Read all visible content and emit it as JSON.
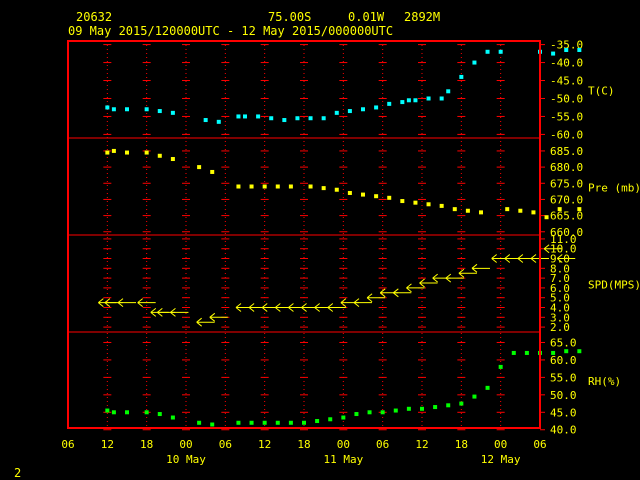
{
  "header": {
    "station": "20632",
    "lat": "75.00S",
    "lon": "0.01W",
    "elev": "2892M",
    "period": "09 May 2015/120000UTC - 12 May 2015/000000UTC"
  },
  "page_number": "2",
  "colors": {
    "frame": "#ff0000",
    "grid": "#ff0000",
    "text": "#ffff00",
    "temperature": "#00ffff",
    "pressure": "#ffff00",
    "wind": "#ffff00",
    "rh": "#00ff00",
    "background": "#000000"
  },
  "chart_data": [
    {
      "type": "scatter",
      "ylabel": "T(C)",
      "ylim": [
        -61,
        -34
      ],
      "ticks": [
        "-35.0",
        "-40.0",
        "-45.0",
        "-50.0",
        "-55.0",
        "-60.0"
      ],
      "tick_values": [
        -35,
        -40,
        -45,
        -50,
        -55,
        -60
      ],
      "x": [
        12,
        13,
        15,
        18,
        20,
        22,
        27,
        29,
        32,
        33,
        35,
        37,
        39,
        41,
        43,
        45,
        47,
        49,
        51,
        53,
        55,
        57,
        58,
        59,
        61,
        63,
        64,
        66,
        68,
        70,
        72,
        78,
        80,
        82,
        84
      ],
      "y": [
        -52.5,
        -53,
        -53,
        -53,
        -53.5,
        -54,
        -56,
        -56.5,
        -55,
        -55,
        -55,
        -55.5,
        -56,
        -55.5,
        -55.5,
        -55.5,
        -54,
        -53.5,
        -53,
        -52.5,
        -51.5,
        -51,
        -50.5,
        -50.5,
        -50,
        -50,
        -48,
        -44,
        -40,
        -37,
        -37,
        -37,
        -37.5,
        -36.5,
        -36.5
      ]
    },
    {
      "type": "scatter",
      "ylabel": "Pre (mb)",
      "ylim": [
        659,
        689
      ],
      "ticks": [
        "685.0",
        "680.0",
        "675.0",
        "670.0",
        "665.0",
        "660.0"
      ],
      "tick_values": [
        685,
        680,
        675,
        670,
        665,
        660
      ],
      "x": [
        12,
        13,
        15,
        18,
        20,
        22,
        26,
        28,
        32,
        34,
        36,
        38,
        40,
        43,
        45,
        47,
        49,
        51,
        53,
        55,
        57,
        59,
        61,
        63,
        65,
        67,
        69,
        73,
        75,
        77,
        79,
        81,
        84
      ],
      "y": [
        684.5,
        685,
        684.5,
        684.5,
        683.5,
        682.5,
        680,
        678.5,
        674,
        674,
        674,
        674,
        674,
        674,
        673.5,
        673,
        672,
        671.5,
        671,
        670.5,
        669.5,
        669,
        668.5,
        668,
        667,
        666.5,
        666,
        667,
        666.5,
        666,
        664.5,
        667,
        667
      ]
    },
    {
      "type": "scatter",
      "ylabel": "SPD(MPS)",
      "ylim": [
        1.5,
        11.4
      ],
      "ticks": [
        "11.0",
        "10.0",
        "9.0",
        "8.0",
        "7.0",
        "6.0",
        "5.0",
        "4.0",
        "3.0",
        "2.0"
      ],
      "tick_values": [
        11,
        10,
        9,
        8,
        7,
        6,
        5,
        4,
        3,
        2
      ],
      "x": [
        12,
        13,
        15,
        18,
        20,
        21,
        23,
        27,
        29,
        33,
        35,
        37,
        39,
        41,
        43,
        45,
        47,
        49,
        51,
        53,
        55,
        57,
        59,
        61,
        63,
        65,
        67,
        69,
        72,
        74,
        76,
        78,
        80,
        82
      ],
      "y": [
        4.5,
        4.5,
        4.5,
        4.5,
        3.5,
        3.5,
        3.5,
        2.5,
        3,
        4,
        4,
        4,
        4,
        4,
        4,
        4,
        4,
        4.5,
        4.5,
        5,
        5.5,
        5.5,
        6,
        6.5,
        7,
        7,
        7.5,
        8,
        9,
        9,
        9,
        9,
        10,
        9
      ]
    },
    {
      "type": "scatter",
      "ylabel": "RH(%)",
      "ylim": [
        40.5,
        68
      ],
      "ticks": [
        "65.0",
        "60.0",
        "55.0",
        "50.0",
        "45.0",
        "40.0"
      ],
      "tick_values": [
        65,
        60,
        55,
        50,
        45,
        40
      ],
      "x": [
        12,
        13,
        15,
        18,
        20,
        22,
        26,
        28,
        32,
        34,
        36,
        38,
        40,
        42,
        44,
        46,
        48,
        50,
        52,
        54,
        56,
        58,
        60,
        62,
        64,
        66,
        68,
        70,
        72,
        74,
        76,
        78,
        80,
        82,
        84
      ],
      "y": [
        45.5,
        45,
        45,
        45,
        44.5,
        43.5,
        42,
        41.5,
        42,
        42,
        42,
        42,
        42,
        42,
        42.5,
        43,
        43.5,
        44.5,
        45,
        45,
        45.5,
        46,
        46,
        46.5,
        47,
        47.5,
        49.5,
        52,
        58,
        62,
        62,
        62,
        62,
        62.5,
        62.5
      ]
    }
  ],
  "x_axis": {
    "ticks": [
      "06",
      "12",
      "18",
      "00",
      "06",
      "12",
      "18",
      "00",
      "06",
      "12",
      "18",
      "00",
      "06"
    ],
    "tick_hours": [
      6,
      12,
      18,
      24,
      30,
      36,
      42,
      48,
      54,
      60,
      66,
      72,
      78
    ],
    "day_labels": [
      "10 May",
      "11 May",
      "12 May"
    ],
    "day_label_hours": [
      24,
      48,
      72
    ],
    "xlim": [
      6,
      78
    ]
  }
}
